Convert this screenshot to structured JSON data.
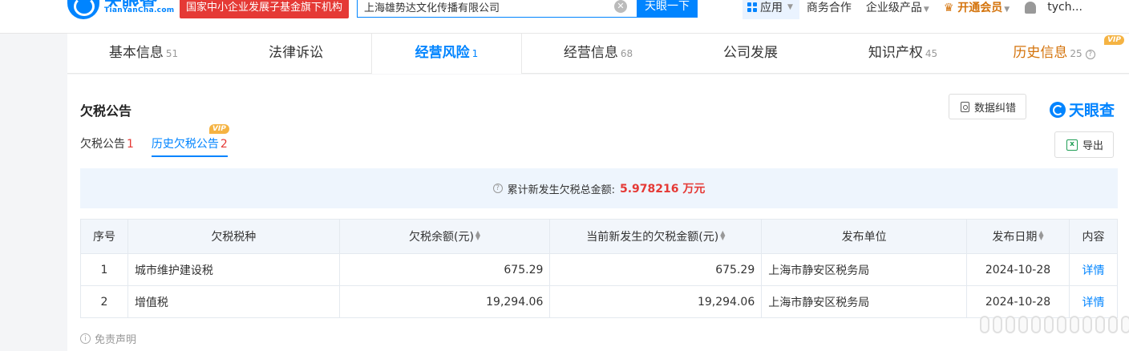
{
  "header": {
    "logo_cn": "天眼查",
    "logo_en": "TianYanCha.com",
    "badge": "国家中小企业发展子基金旗下机构",
    "search_value": "上海雄势达文化传播有限公司",
    "search_clear": "✕",
    "search_button": "天眼一下",
    "nav": {
      "app": "应用",
      "business": "商务合作",
      "enterprise": "企业级产品",
      "vip": "开通会员",
      "user": "tych..."
    }
  },
  "tabs": [
    {
      "label": "基本信息",
      "count": "51"
    },
    {
      "label": "法律诉讼",
      "count": ""
    },
    {
      "label": "经营风险",
      "count": "1"
    },
    {
      "label": "经营信息",
      "count": "68"
    },
    {
      "label": "公司发展",
      "count": ""
    },
    {
      "label": "知识产权",
      "count": "45"
    },
    {
      "label": "历史信息",
      "count": "25",
      "vip": "VIP"
    }
  ],
  "section": {
    "title": "欠税公告",
    "correct_button": "数据纠错",
    "brand": "天眼查",
    "export_button": "导出",
    "excel_glyph": "x",
    "subtabs": [
      {
        "label": "欠税公告",
        "count": "1"
      },
      {
        "label": "历史欠税公告",
        "count": "2",
        "vip": "VIP"
      }
    ],
    "summary_label": "累计新发生欠税总金额:",
    "summary_amount": "5.978216 万元",
    "help_glyph": "?",
    "table": {
      "headers": [
        "序号",
        "欠税税种",
        "欠税余额(元)",
        "当前新发生的欠税金额(元)",
        "发布单位",
        "发布日期",
        "内容"
      ],
      "rows": [
        {
          "idx": "1",
          "type": "城市维护建设税",
          "balance": "675.29",
          "new_amount": "675.29",
          "unit": "上海市静安区税务局",
          "date": "2024-10-28",
          "content": "详情"
        },
        {
          "idx": "2",
          "type": "增值税",
          "balance": "19,294.06",
          "new_amount": "19,294.06",
          "unit": "上海市静安区税务局",
          "date": "2024-10-28",
          "content": "详情"
        }
      ]
    },
    "disclaimer": "免责声明",
    "info_glyph": "i"
  }
}
